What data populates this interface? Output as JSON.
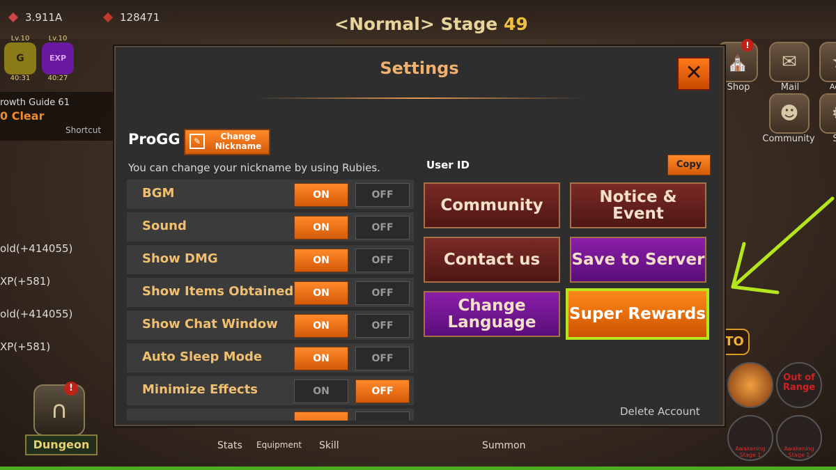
{
  "hud": {
    "gold": "3.911A",
    "rubies": "128471",
    "stage_mode": "<Normal>",
    "stage_word": "Stage",
    "stage_number": "49",
    "gold_boost": {
      "level": "Lv.10",
      "timer": "40:31"
    },
    "exp_boost": {
      "level": "Lv.10",
      "label": "EXP",
      "timer": "40:27"
    },
    "growth_guide": "rowth Guide 61",
    "guide_status": "0 Clear",
    "shortcut": "Shortcut",
    "log": [
      "old(+414055)",
      "XP(+581)",
      "old(+414055)",
      "XP(+581)"
    ],
    "right_menu": [
      {
        "label": "Shop",
        "icon": "shop-icon"
      },
      {
        "label": "Mail",
        "icon": "mail-icon"
      },
      {
        "label": "Achie",
        "icon": "achievement-icon"
      },
      {
        "label": "Community",
        "icon": "community-icon"
      },
      {
        "label": "Set",
        "icon": "settings-icon"
      }
    ],
    "auto_label": "TO",
    "skill_out_of_range": "Out of Range",
    "awakening_labels": [
      "Awakening Stage 1",
      "Awakening Stage 1"
    ],
    "dungeon": "Dungeon",
    "bottom_nav": [
      "Stats",
      "Equipment",
      "Skill",
      "Summon"
    ]
  },
  "settings": {
    "title": "Settings",
    "close_icon": "close-icon",
    "nickname": "ProGG",
    "change_nickname": "Change Nickname",
    "hint": "You can change your nickname by using Rubies.",
    "toggles": [
      {
        "label": "BGM",
        "on": "ON",
        "off": "OFF",
        "value": "ON"
      },
      {
        "label": "Sound",
        "on": "ON",
        "off": "OFF",
        "value": "ON"
      },
      {
        "label": "Show DMG",
        "on": "ON",
        "off": "OFF",
        "value": "ON"
      },
      {
        "label": "Show Items Obtained",
        "on": "ON",
        "off": "OFF",
        "value": "ON"
      },
      {
        "label": "Show Chat Window",
        "on": "ON",
        "off": "OFF",
        "value": "ON"
      },
      {
        "label": "Auto Sleep Mode",
        "on": "ON",
        "off": "OFF",
        "value": "ON"
      },
      {
        "label": "Minimize Effects",
        "on": "ON",
        "off": "OFF",
        "value": "OFF"
      }
    ],
    "user_id_label": "User ID",
    "copy": "Copy",
    "buttons": {
      "community": "Community",
      "notice_event": "Notice & Event",
      "contact_us": "Contact us",
      "save_server": "Save to Server",
      "change_language": "Change Language",
      "super_rewards": "Super Rewards"
    },
    "delete_account": "Delete Account",
    "highlight_color": "#b5e61d"
  }
}
